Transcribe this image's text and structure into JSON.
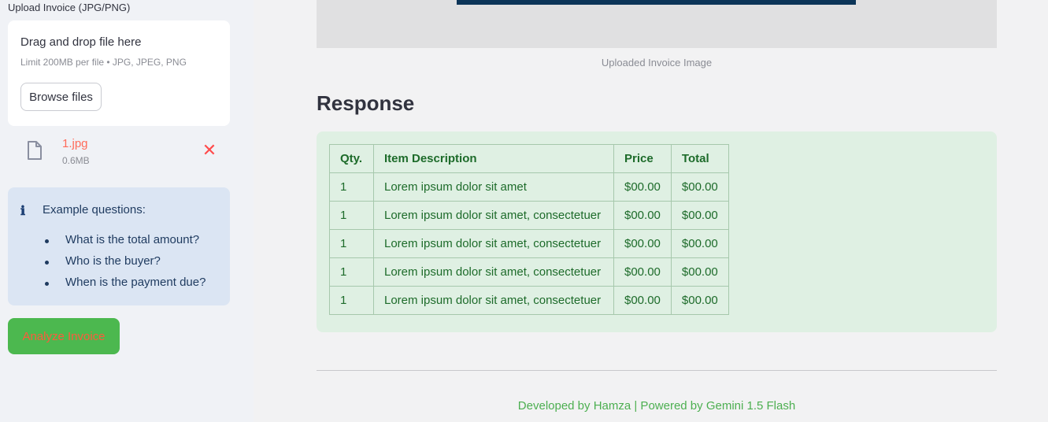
{
  "sidebar": {
    "upload_label": "Upload Invoice (JPG/PNG)",
    "dropzone": {
      "title": "Drag and drop file here",
      "limit": "Limit 200MB per file • JPG, JPEG, PNG",
      "browse_label": "Browse files"
    },
    "file": {
      "name": "1.jpg",
      "size": "0.6MB",
      "remove_glyph": "✕"
    },
    "info": {
      "icon": "ℹ",
      "title": "Example questions:",
      "items": [
        "What is the total amount?",
        "Who is the buyer?",
        "When is the payment due?"
      ]
    },
    "analyze_label": "Analyze Invoice"
  },
  "main": {
    "image_caption": "Uploaded Invoice Image",
    "response_heading": "Response",
    "table": {
      "headers": [
        "Qty.",
        "Item Description",
        "Price",
        "Total"
      ],
      "rows": [
        [
          "1",
          "Lorem ipsum dolor sit amet",
          "$00.00",
          "$00.00"
        ],
        [
          "1",
          "Lorem ipsum dolor sit amet, consectetuer",
          "$00.00",
          "$00.00"
        ],
        [
          "1",
          "Lorem ipsum dolor sit amet, consectetuer",
          "$00.00",
          "$00.00"
        ],
        [
          "1",
          "Lorem ipsum dolor sit amet, consectetuer",
          "$00.00",
          "$00.00"
        ],
        [
          "1",
          "Lorem ipsum dolor sit amet, consectetuer",
          "$00.00",
          "$00.00"
        ]
      ]
    },
    "footer": "Developed by Hamza | Powered by Gemini 1.5 Flash"
  },
  "colors": {
    "analyze_button_bg": "#4cb84f",
    "analyze_button_text": "#ff5a3c",
    "response_bg": "#dff0e3",
    "response_text": "#1d6b2a",
    "info_bg": "#dbe5f3",
    "image_top_bar": "#0c3558"
  },
  "icons": {
    "file": "file-icon",
    "remove": "close-icon",
    "info": "info-icon"
  }
}
